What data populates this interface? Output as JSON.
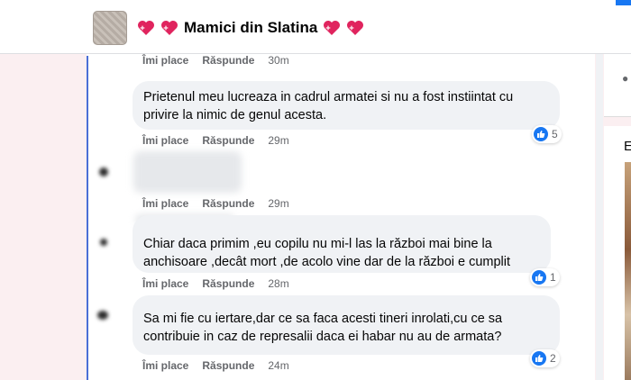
{
  "group": {
    "name": "Mamici din Slatina",
    "avatar_icon": "group-avatar-image",
    "heart_icon": "sparkling-heart-icon"
  },
  "actions": {
    "like": "Îmi place",
    "reply": "Răspunde"
  },
  "comments": [
    {
      "time": "30m"
    },
    {
      "text": "Prietenul meu lucreaza in cadrul armatei si nu a fost instiintat cu privire la nimic de genul acesta.",
      "reactions": "5",
      "time": "29m"
    },
    {
      "time": "29m"
    },
    {
      "text": "Chiar daca primim ,eu copilu nu mi-l las la război mai bine la anchisoare ,decât mort ,de acolo vine dar de la război e cumplit",
      "reactions": "1",
      "time": "28m"
    },
    {
      "text": "Sa mi fie cu iertare,dar ce sa faca acesti tineri inrolati,cu ce sa contribuie in caz de represalii daca ei habar nu au de armata?",
      "reactions": "2",
      "time": "24m"
    }
  ],
  "colors": {
    "accent": "#1877f2",
    "thread_line": "#4a6fd6",
    "bubble": "#f0f2f5",
    "muted": "#65676b"
  },
  "right_panel": {
    "letter": "E"
  }
}
